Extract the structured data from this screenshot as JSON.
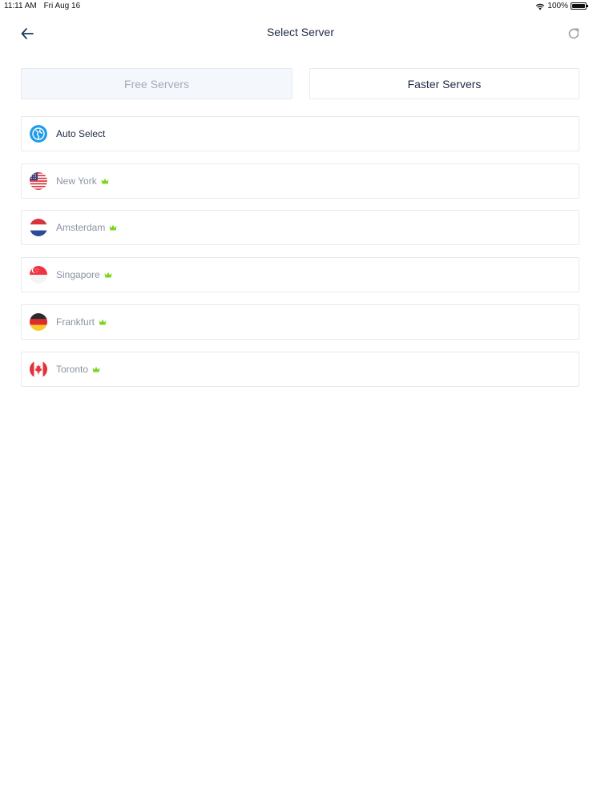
{
  "status_bar": {
    "time": "11:11 AM",
    "date": "Fri Aug 16",
    "battery": "100%"
  },
  "header": {
    "title": "Select Server",
    "back_icon": "arrow-left-icon",
    "refresh_icon": "refresh-icon"
  },
  "tabs": [
    {
      "label": "Free Servers",
      "selected": false
    },
    {
      "label": "Faster Servers",
      "selected": true
    }
  ],
  "servers": [
    {
      "name": "Auto Select",
      "icon": "auto-select-icon",
      "premium": false
    },
    {
      "name": "New York",
      "icon": "us-flag-icon",
      "premium": true
    },
    {
      "name": "Amsterdam",
      "icon": "nl-flag-icon",
      "premium": true
    },
    {
      "name": "Singapore",
      "icon": "sg-flag-icon",
      "premium": true
    },
    {
      "name": "Frankfurt",
      "icon": "de-flag-icon",
      "premium": true
    },
    {
      "name": "Toronto",
      "icon": "ca-flag-icon",
      "premium": true
    }
  ],
  "colors": {
    "accent": "#1e9be9",
    "crown": "#7ed321",
    "title_text": "#1f2a44",
    "muted_text": "#8a93a3",
    "tab_inactive_bg": "#f4f8fd"
  }
}
